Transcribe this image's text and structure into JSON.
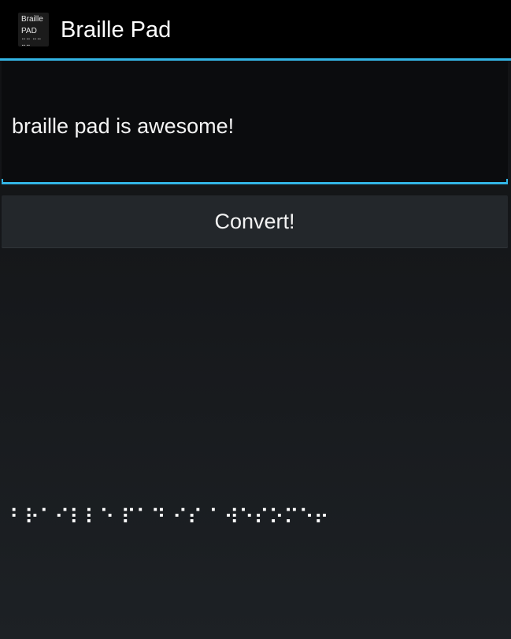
{
  "app": {
    "title": "Braille Pad",
    "icon": {
      "name": "braille-pad-app-icon",
      "line1": "Braille",
      "line2": "PAD",
      "line3": "⠒⠒ ⠒⠒ ⠒⠒"
    }
  },
  "input": {
    "value": "braille pad is awesome!"
  },
  "convert_button": {
    "label": "Convert!"
  },
  "output": {
    "braille": "⠃⠗⠁⠊⠇⠇⠑ ⠏⠁⠙ ⠊⠎ ⠁⠺⠑⠎⠕⠍⠑⠖"
  },
  "colors": {
    "accent": "#33b5e5",
    "action_bar": "#000000",
    "background": "#141619",
    "button": "#23272b"
  }
}
